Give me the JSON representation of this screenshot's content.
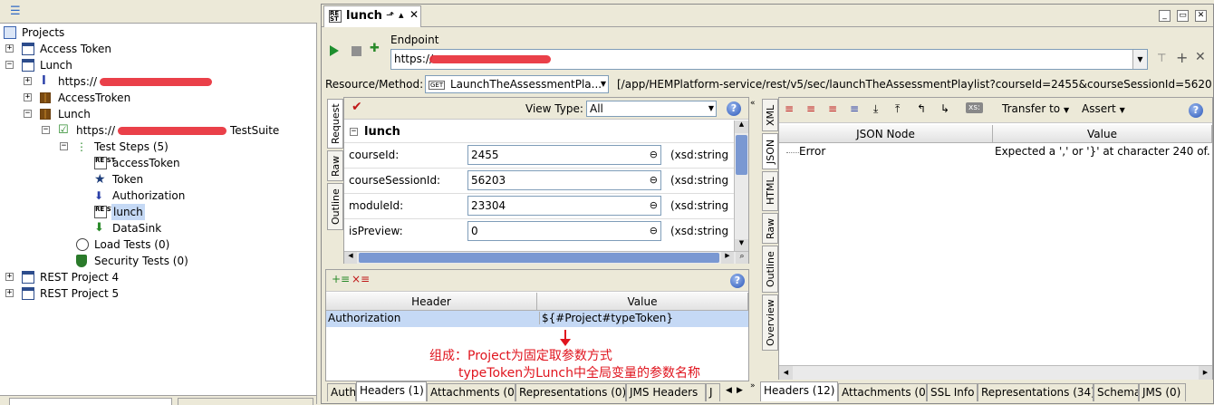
{
  "navigator": {
    "root": "Projects",
    "items": [
      {
        "label": "Access Token"
      },
      {
        "label": "Lunch"
      },
      {
        "label": "https://"
      },
      {
        "label": "AccessTroken"
      },
      {
        "label": "Lunch"
      },
      {
        "label": "https://"
      },
      {
        "label": "TestSuite"
      },
      {
        "label": "Test Steps (5)"
      },
      {
        "label": "accessToken"
      },
      {
        "label": "Token"
      },
      {
        "label": "Authorization"
      },
      {
        "label": "lunch"
      },
      {
        "label": "DataSink"
      },
      {
        "label": "Load Tests (0)"
      },
      {
        "label": "Security Tests (0)"
      },
      {
        "label": "REST Project 4"
      },
      {
        "label": "REST Project 5"
      }
    ]
  },
  "editor": {
    "tab_title": "lunch",
    "endpoint_label": "Endpoint",
    "endpoint_value": "https://",
    "resource_label": "Resource/Method:",
    "method_badge": "GET",
    "method_value": "LaunchTheAssessmentPla...",
    "resource_path": "[/app/HEMPlatform-service/rest/v5/sec/launchTheAssessmentPlaylist?courseId=2455&courseSessionId=56203&r"
  },
  "request": {
    "side_tabs": [
      "Request",
      "Raw",
      "Outline"
    ],
    "view_type_label": "View Type:",
    "view_type_value": "All",
    "section_title": "lunch",
    "params": [
      {
        "name": "courseId:",
        "value": "2455",
        "type": "(xsd:string"
      },
      {
        "name": "courseSessionId:",
        "value": "56203",
        "type": "(xsd:string"
      },
      {
        "name": "moduleId:",
        "value": "23304",
        "type": "(xsd:string"
      },
      {
        "name": "isPreview:",
        "value": "0",
        "type": "(xsd:string"
      }
    ]
  },
  "headers": {
    "col_header": "Header",
    "col_value": "Value",
    "rows": [
      {
        "header": "Authorization",
        "value": "${#Project#typeToken}"
      }
    ],
    "annotation_line1": "组成：Project为固定取参数方式",
    "annotation_line2": "typeToken为Lunch中全局变量的参数名称",
    "bottom_tabs": [
      "Auth",
      "Headers (1)",
      "Attachments (0)",
      "Representations (0)",
      "JMS Headers",
      "J"
    ]
  },
  "response": {
    "side_tabs": [
      "XML",
      "JSON",
      "HTML",
      "Raw",
      "Outline",
      "Overview"
    ],
    "transfer_label": "Transfer to",
    "assert_label": "Assert",
    "xs_label": "xs:",
    "col_node": "JSON Node",
    "col_value": "Value",
    "rows": [
      {
        "node": "Error",
        "value": "Expected a ',' or '}' at character 240 of..."
      }
    ],
    "bottom_tabs": [
      "Headers (12)",
      "Attachments (0)",
      "SSL Info",
      "Representations (34)",
      "Schema",
      "JMS (0)"
    ]
  },
  "colors": {
    "accent": "#316ac5",
    "annotation": "#e0141e",
    "selection": "#c5d9f5"
  }
}
